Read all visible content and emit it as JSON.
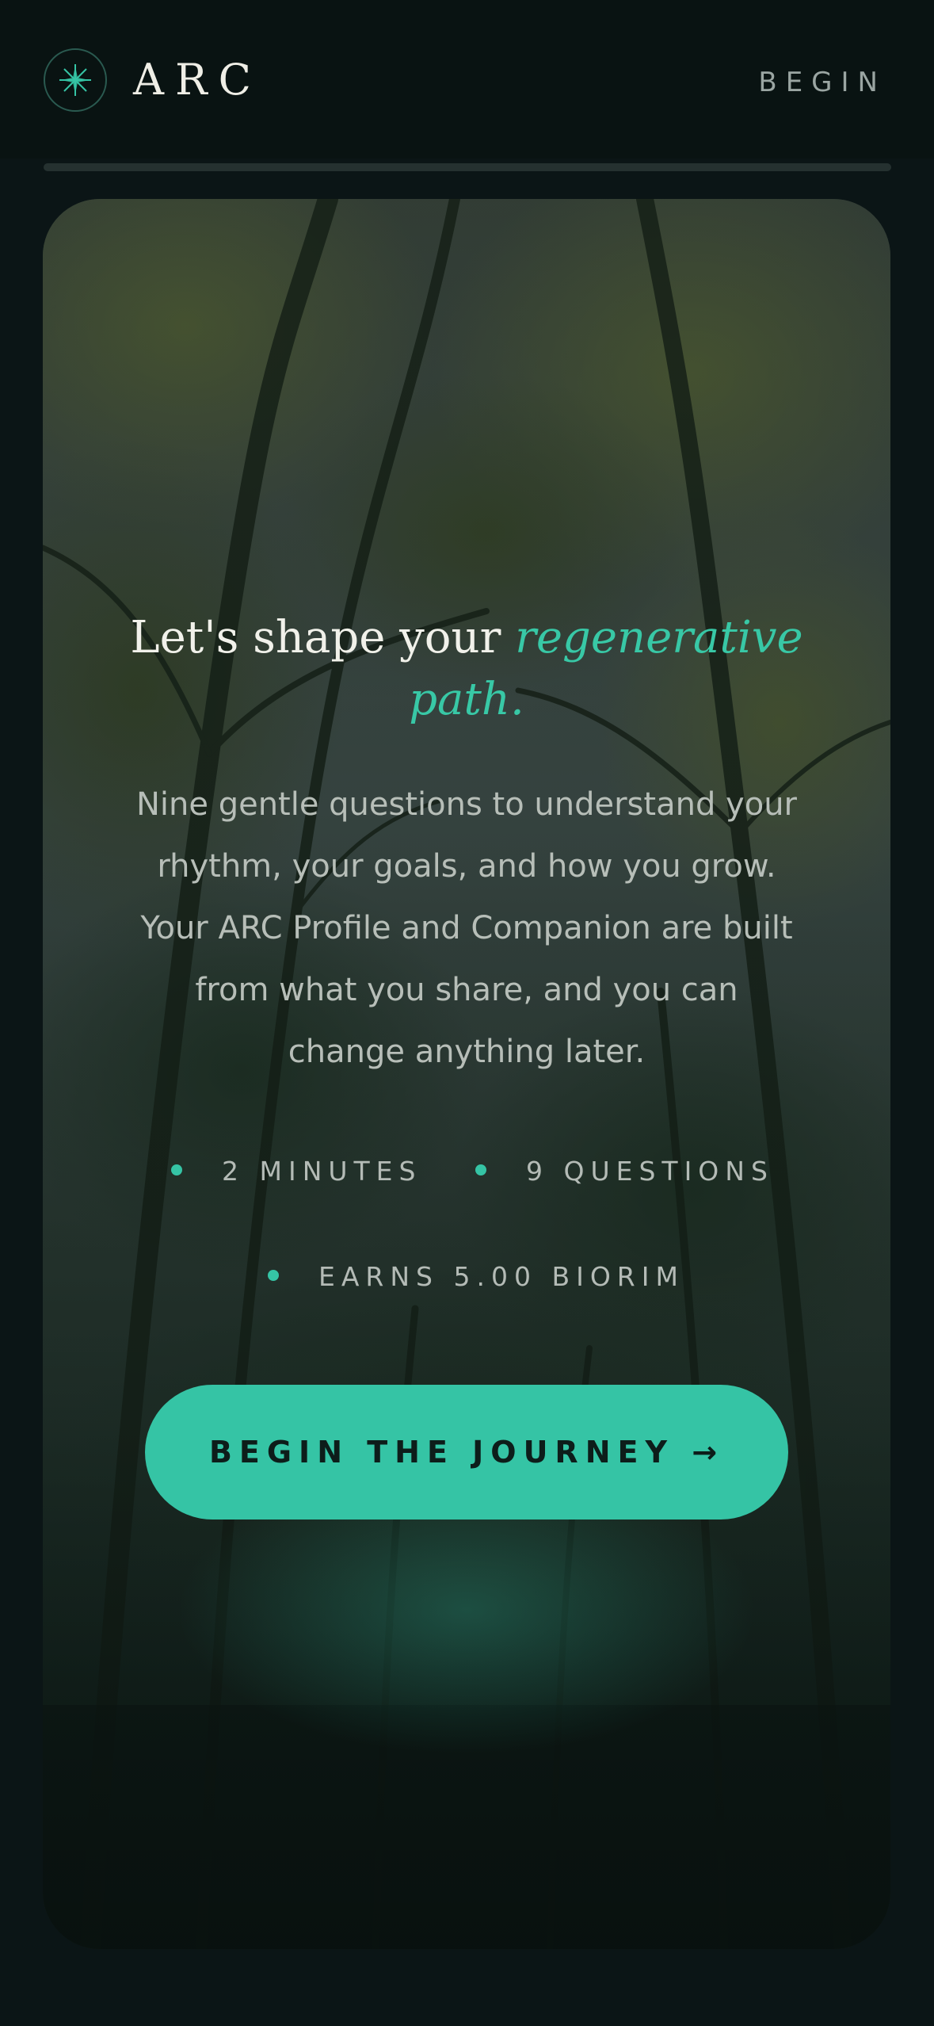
{
  "header": {
    "brand": "ARC",
    "begin_label": "BEGIN",
    "logo_icon": "compass-star-icon"
  },
  "progress": {
    "fraction": 0
  },
  "hero": {
    "background": "forest-canopy-photo",
    "headline_prefix": "Let's shape your ",
    "headline_accent": "regenerative path.",
    "description": "Nine gentle questions to understand your rhythm, your goals, and how you grow. Your ARC Profile and Companion are built from what you share, and you can change anything later.",
    "meta": [
      "2 MINUTES",
      "9 QUESTIONS",
      "EARNS 5.00 BIORIM"
    ],
    "cta_label": "BEGIN THE JOURNEY →"
  },
  "colors": {
    "accent": "#35c4a5",
    "background": "#0b1516",
    "text": "#f1f1ea"
  }
}
